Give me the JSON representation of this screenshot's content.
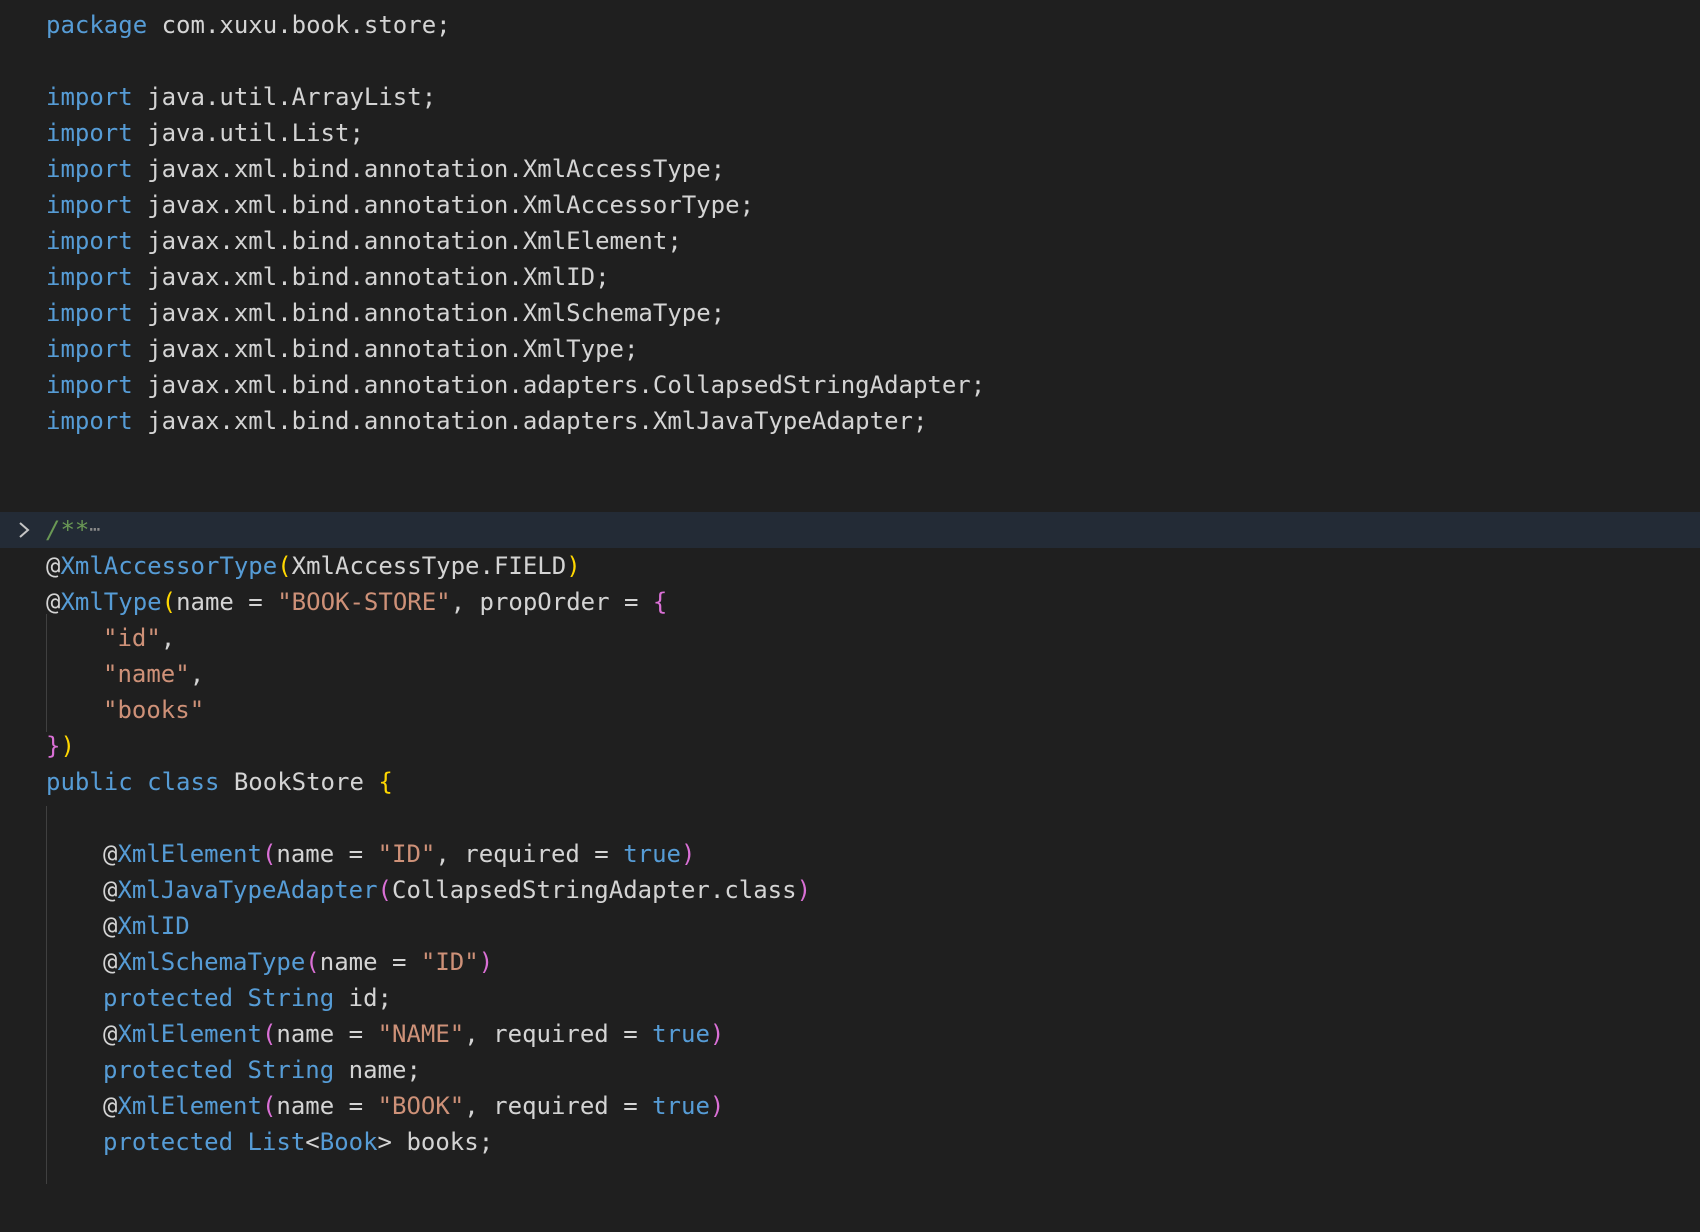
{
  "editor": {
    "language": "java",
    "colors": {
      "background": "#1f1f1f",
      "keyword": "#569cd6",
      "string": "#ce9178",
      "comment": "#6a9955",
      "bracket_gold": "#ffd700",
      "bracket_pink": "#da70d6",
      "text": "#d4d4d4",
      "highlight_line": "#232b36"
    },
    "lines": {
      "l01": {
        "kw": "package",
        "rest": " com.xuxu.book.store;"
      },
      "l03": {
        "kw": "import",
        "rest": " java.util.ArrayList;"
      },
      "l04": {
        "kw": "import",
        "rest": " java.util.List;"
      },
      "l05": {
        "kw": "import",
        "rest": " javax.xml.bind.annotation.XmlAccessType;"
      },
      "l06": {
        "kw": "import",
        "rest": " javax.xml.bind.annotation.XmlAccessorType;"
      },
      "l07": {
        "kw": "import",
        "rest": " javax.xml.bind.annotation.XmlElement;"
      },
      "l08": {
        "kw": "import",
        "rest": " javax.xml.bind.annotation.XmlID;"
      },
      "l09": {
        "kw": "import",
        "rest": " javax.xml.bind.annotation.XmlSchemaType;"
      },
      "l10": {
        "kw": "import",
        "rest": " javax.xml.bind.annotation.XmlType;"
      },
      "l11": {
        "kw": "import",
        "rest": " javax.xml.bind.annotation.adapters.CollapsedStringAdapter;"
      },
      "l12": {
        "kw": "import",
        "rest": " javax.xml.bind.annotation.adapters.XmlJavaTypeAdapter;"
      },
      "l15": {
        "comment": "/**",
        "ellipsis": "⋯"
      },
      "l16": {
        "at": "@",
        "name": "XmlAccessorType",
        "open": "(",
        "arg": "XmlAccessType.FIELD",
        "close": ")"
      },
      "l17": {
        "at": "@",
        "name": "XmlType",
        "open": "(",
        "arg1": "name = ",
        "str": "\"BOOK-STORE\"",
        "arg2": ", propOrder = ",
        "brace": "{"
      },
      "l18": {
        "str": "\"id\"",
        "tail": ","
      },
      "l19": {
        "str": "\"name\"",
        "tail": ","
      },
      "l20": {
        "str": "\"books\""
      },
      "l21": {
        "brace": "}",
        "close": ")"
      },
      "l22": {
        "kw1": "public",
        "kw2": "class",
        "name": " BookStore ",
        "brace": "{"
      },
      "l24": {
        "at": "@",
        "name": "XmlElement",
        "open": "(",
        "arg1": "name = ",
        "str": "\"ID\"",
        "arg2": ", required = ",
        "val": "true",
        "close": ")"
      },
      "l25": {
        "at": "@",
        "name": "XmlJavaTypeAdapter",
        "open": "(",
        "arg": "CollapsedStringAdapter.class",
        "close": ")"
      },
      "l26": {
        "at": "@",
        "name": "XmlID"
      },
      "l27": {
        "at": "@",
        "name": "XmlSchemaType",
        "open": "(",
        "arg1": "name = ",
        "str": "\"ID\"",
        "close": ")"
      },
      "l28": {
        "kw": "protected",
        "ty": "String",
        "rest": " id;"
      },
      "l29": {
        "at": "@",
        "name": "XmlElement",
        "open": "(",
        "arg1": "name = ",
        "str": "\"NAME\"",
        "arg2": ", required = ",
        "val": "true",
        "close": ")"
      },
      "l30": {
        "kw": "protected",
        "ty": "String",
        "rest": " name;"
      },
      "l31": {
        "at": "@",
        "name": "XmlElement",
        "open": "(",
        "arg1": "name = ",
        "str": "\"BOOK\"",
        "arg2": ", required = ",
        "val": "true",
        "close": ")"
      },
      "l32": {
        "kw": "protected",
        "ty": "List",
        "lt": "<",
        "ty2": "Book",
        "gt": ">",
        "rest": " books;"
      }
    }
  }
}
